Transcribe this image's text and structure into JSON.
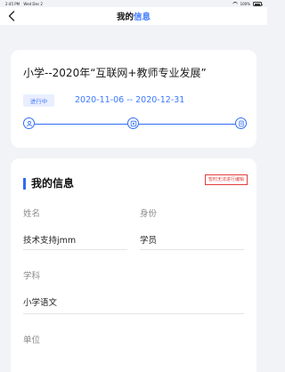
{
  "status_bar": {
    "time": "2:45 PM",
    "date": "Wed Dec 2",
    "battery": "100%"
  },
  "nav": {
    "title_part1": "我的",
    "title_part2": "信息"
  },
  "course": {
    "title": "小学--2020年“互联网+教师专业发展”",
    "status": "进行中",
    "date_range": "2020-11-06 -- 2020-12-31"
  },
  "info": {
    "section_title": "我的信息",
    "stamp_text": "暂时无法进行编辑",
    "fields": [
      {
        "label": "姓名",
        "value": "技术支持jmm"
      },
      {
        "label": "身份",
        "value": "学员"
      },
      {
        "label": "学科",
        "value": "小学语文"
      },
      {
        "label": "单位",
        "value": ""
      }
    ]
  },
  "colors": {
    "accent": "#3a78ff",
    "stamp": "#e13d3d",
    "background": "#f2f3f6"
  }
}
